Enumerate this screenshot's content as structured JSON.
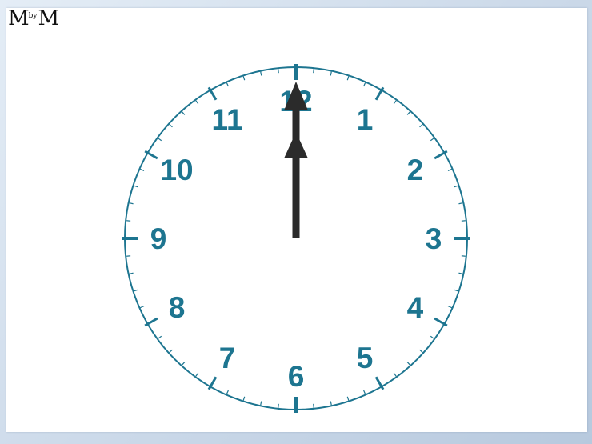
{
  "logo": {
    "left": "M",
    "middle": "by",
    "right": "M"
  },
  "clock": {
    "numerals": [
      "12",
      "1",
      "2",
      "3",
      "4",
      "5",
      "6",
      "7",
      "8",
      "9",
      "10",
      "11"
    ],
    "time": {
      "hour": 12,
      "minute": 0
    },
    "colors": {
      "dial": "#1d7590",
      "hands": "#2b2b2b",
      "face": "#ffffff"
    }
  }
}
